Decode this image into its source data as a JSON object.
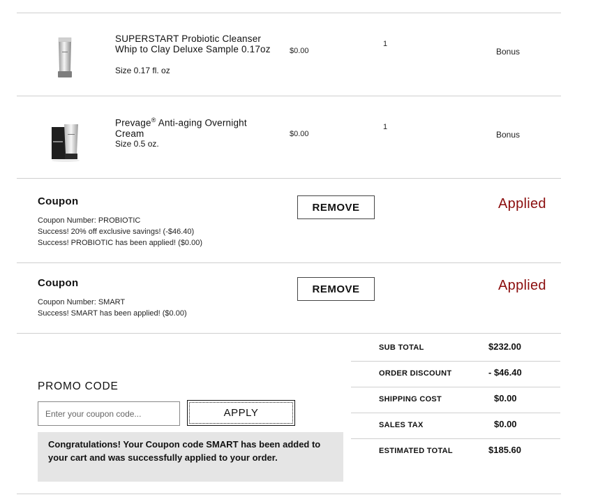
{
  "products": [
    {
      "name": "SUPERSTART Probiotic Cleanser Whip to Clay Deluxe Sample 0.17oz",
      "size": "Size 0.17 fl. oz",
      "price": "$0.00",
      "qty": "1",
      "type": "Bonus"
    },
    {
      "name_main": "Prevage",
      "name_sup": "®",
      "name_rest": " Anti-aging Overnight Cream",
      "size": "Size 0.5 oz.",
      "price": "$0.00",
      "qty": "1",
      "type": "Bonus"
    }
  ],
  "coupons": [
    {
      "title": "Coupon",
      "lines": [
        "Coupon Number: PROBIOTIC",
        "Success! 20% off exclusive savings! (-$46.40)",
        "Success! PROBIOTIC has been applied! ($0.00)"
      ],
      "remove_label": "REMOVE",
      "status": "Applied"
    },
    {
      "title": "Coupon",
      "lines": [
        "Coupon Number: SMART",
        "Success! SMART has been applied! ($0.00)"
      ],
      "remove_label": "REMOVE",
      "status": "Applied"
    }
  ],
  "promo": {
    "label": "PROMO CODE",
    "placeholder": "Enter your coupon code...",
    "apply_label": "APPLY",
    "message": "Congratulations! Your Coupon code SMART has been added to your cart and was successfully applied to your order."
  },
  "totals": [
    {
      "label": "SUB TOTAL",
      "value": "$232.00"
    },
    {
      "label": "ORDER DISCOUNT",
      "value": "- $46.40"
    },
    {
      "label": "SHIPPING COST",
      "value": "$0.00"
    },
    {
      "label": "SALES TAX",
      "value": "$0.00"
    },
    {
      "label": "ESTIMATED TOTAL",
      "value": "$185.60"
    }
  ],
  "colors": {
    "applied": "#8b0d0d",
    "divider": "#cfcfcf",
    "message_bg": "#e5e5e5"
  }
}
